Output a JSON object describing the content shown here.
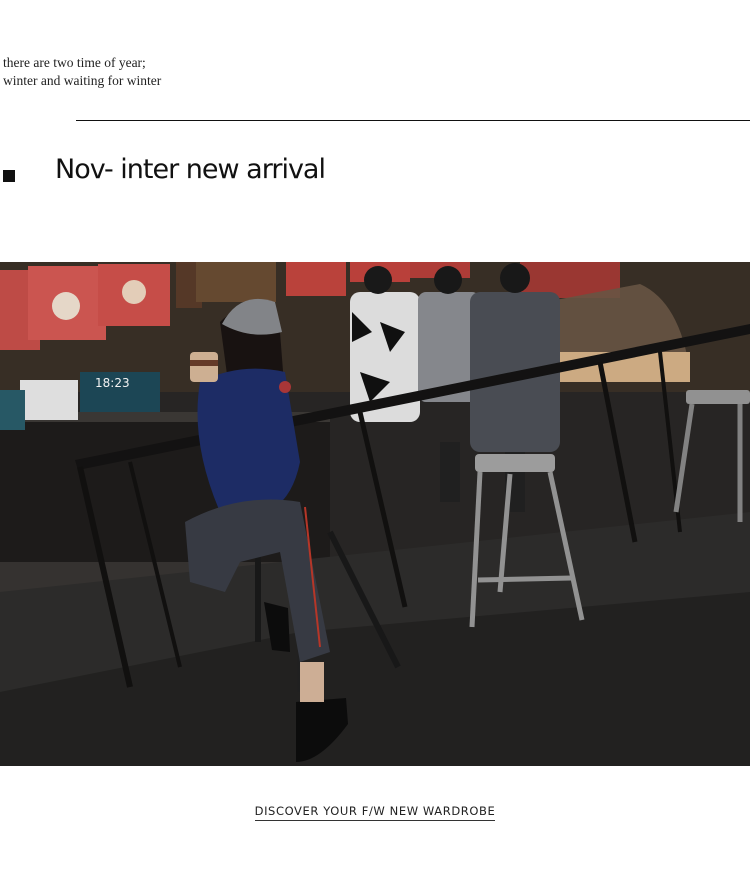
{
  "tagline": {
    "line1": "there are two time of year;",
    "line2": "winter and waiting for winter"
  },
  "headline": "Nov- inter new arrival",
  "photo": {
    "store_sign": "18:23"
  },
  "cta": {
    "label": "DISCOVER YOUR F/W NEW WARDROBE"
  },
  "colors": {
    "background": "#ffffff",
    "text": "#111111",
    "accent_red": "#c0392b"
  }
}
